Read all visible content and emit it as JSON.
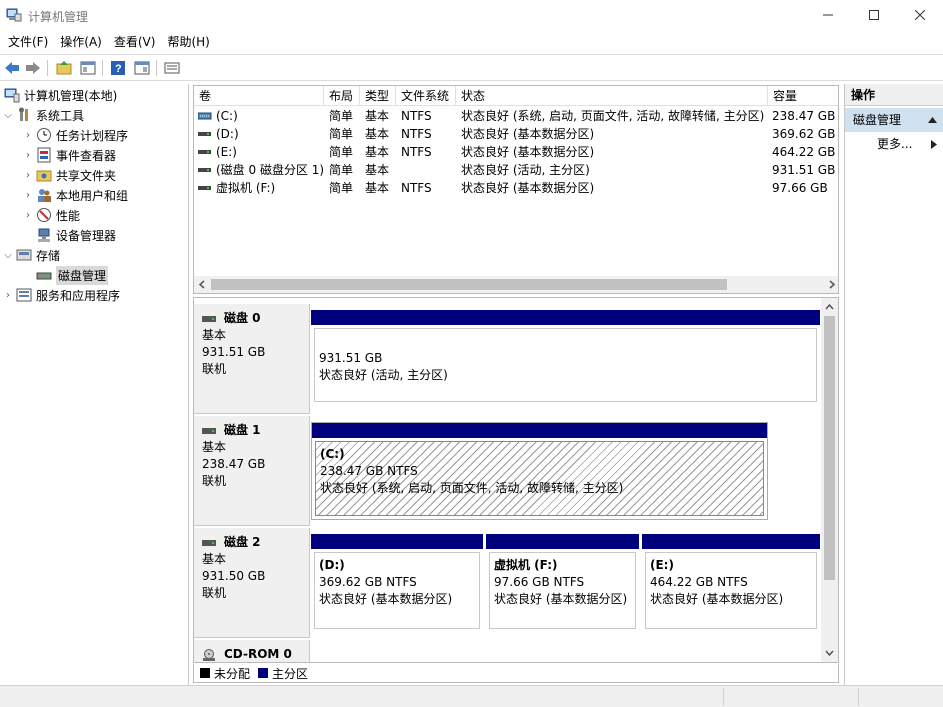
{
  "window": {
    "title": "计算机管理",
    "minimize": "—",
    "maximize": "☐",
    "close": "✕"
  },
  "menu": [
    "文件(F)",
    "操作(A)",
    "查看(V)",
    "帮助(H)"
  ],
  "tree": {
    "root": "计算机管理(本地)",
    "system_tools": "系统工具",
    "task_scheduler": "任务计划程序",
    "event_viewer": "事件查看器",
    "shared_folders": "共享文件夹",
    "local_users": "本地用户和组",
    "performance": "性能",
    "device_manager": "设备管理器",
    "storage": "存储",
    "disk_management": "磁盘管理",
    "services_apps": "服务和应用程序"
  },
  "volume_list": {
    "headers": [
      "卷",
      "布局",
      "类型",
      "文件系统",
      "状态",
      "容量"
    ],
    "rows": [
      [
        "(C:)",
        "简单",
        "基本",
        "NTFS",
        "状态良好 (系统, 启动, 页面文件, 活动, 故障转储, 主分区)",
        "238.47 GB"
      ],
      [
        "(D:)",
        "简单",
        "基本",
        "NTFS",
        "状态良好 (基本数据分区)",
        "369.62 GB"
      ],
      [
        "(E:)",
        "简单",
        "基本",
        "NTFS",
        "状态良好 (基本数据分区)",
        "464.22 GB"
      ],
      [
        "(磁盘 0 磁盘分区 1)",
        "简单",
        "基本",
        "",
        "状态良好 (活动, 主分区)",
        "931.51 GB"
      ],
      [
        "虚拟机 (F:)",
        "简单",
        "基本",
        "NTFS",
        "状态良好 (基本数据分区)",
        "97.66 GB"
      ]
    ]
  },
  "disks": [
    {
      "name": "磁盘 0",
      "type": "基本",
      "size": "931.51 GB",
      "state": "联机",
      "partitions": [
        {
          "name": "",
          "size": "931.51 GB",
          "status": "状态良好 (活动, 主分区)"
        }
      ]
    },
    {
      "name": "磁盘 1",
      "type": "基本",
      "size": "238.47 GB",
      "state": "联机",
      "partitions": [
        {
          "name": "(C:)",
          "size": "238.47 GB NTFS",
          "status": "状态良好 (系统, 启动, 页面文件, 活动, 故障转储, 主分区)"
        }
      ]
    },
    {
      "name": "磁盘 2",
      "type": "基本",
      "size": "931.50 GB",
      "state": "联机",
      "partitions": [
        {
          "name": "(D:)",
          "size": "369.62 GB NTFS",
          "status": "状态良好 (基本数据分区)"
        },
        {
          "name": "虚拟机  (F:)",
          "size": "97.66 GB NTFS",
          "status": "状态良好 (基本数据分区)"
        },
        {
          "name": "(E:)",
          "size": "464.22 GB NTFS",
          "status": "状态良好 (基本数据分区)"
        }
      ]
    },
    {
      "name": "CD-ROM 0"
    }
  ],
  "legend": {
    "unallocated": "未分配",
    "primary": "主分区",
    "unallocated_color": "#000000",
    "primary_color": "#00007f"
  },
  "actions": {
    "header": "操作",
    "section": "磁盘管理",
    "more": "更多..."
  },
  "colors": {
    "partition_bar": "#00007f",
    "selected_action": "#cfe0f0"
  }
}
